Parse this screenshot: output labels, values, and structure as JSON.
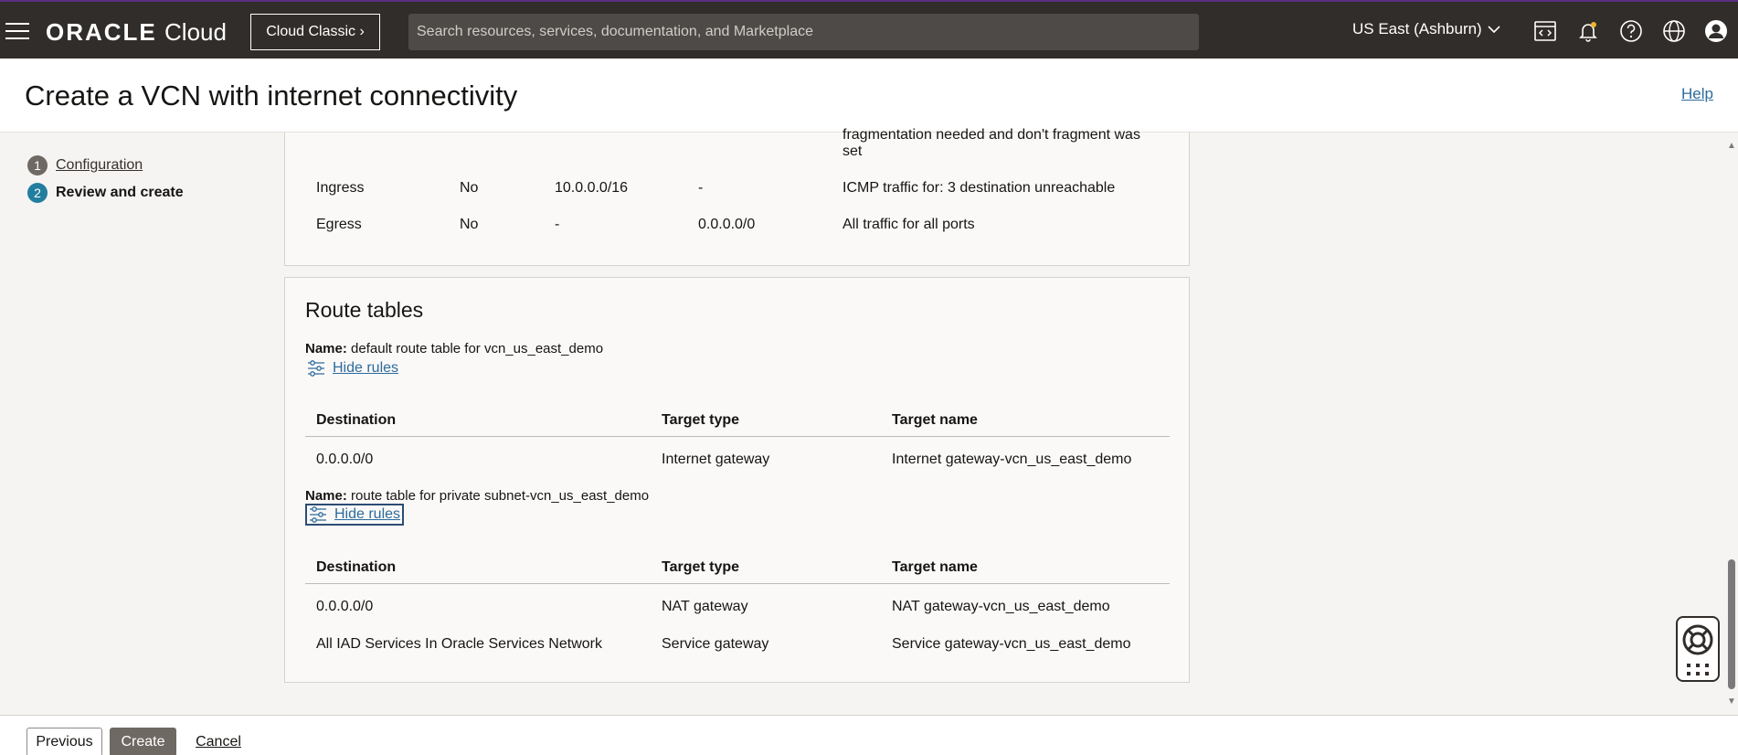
{
  "topbar": {
    "brand_strong": "ORACLE",
    "brand_light": "Cloud",
    "classic_button": "Cloud Classic",
    "search_placeholder": "Search resources, services, documentation, and Marketplace",
    "region": "US East (Ashburn)"
  },
  "header": {
    "title": "Create a VCN with internet connectivity",
    "help": "Help"
  },
  "steps": [
    {
      "num": "1",
      "label": "Configuration",
      "state": "completed"
    },
    {
      "num": "2",
      "label": "Review and create",
      "state": "current"
    }
  ],
  "security_rules": {
    "partial_desc": "fragmentation needed and don't fragment was",
    "partial_desc_tail": "set",
    "rows": [
      {
        "direction": "Ingress",
        "stateless": "No",
        "source": "10.0.0.0/16",
        "destination": "-",
        "description": "ICMP traffic for: 3 destination unreachable"
      },
      {
        "direction": "Egress",
        "stateless": "No",
        "source": "-",
        "destination": "0.0.0.0/0",
        "description": "All traffic for all ports"
      }
    ]
  },
  "route_tables": {
    "title": "Route tables",
    "name_label": "Name:",
    "hide_rules": "Hide rules",
    "columns": [
      "Destination",
      "Target type",
      "Target name"
    ],
    "tables": [
      {
        "name": "default route table for vcn_us_east_demo",
        "rows": [
          {
            "destination": "0.0.0.0/0",
            "target_type": "Internet gateway",
            "target_name": "Internet gateway-vcn_us_east_demo"
          }
        ]
      },
      {
        "name": "route table for private subnet-vcn_us_east_demo",
        "rows": [
          {
            "destination": "0.0.0.0/0",
            "target_type": "NAT gateway",
            "target_name": "NAT gateway-vcn_us_east_demo"
          },
          {
            "destination": "All IAD Services In Oracle Services Network",
            "target_type": "Service gateway",
            "target_name": "Service gateway-vcn_us_east_demo"
          }
        ]
      }
    ]
  },
  "footer": {
    "previous": "Previous",
    "create": "Create",
    "cancel": "Cancel"
  },
  "colors": {
    "topbar": "#312d2a",
    "link": "#2c6b9c",
    "step_active": "#227e9e",
    "primary_button": "#6f6964"
  }
}
